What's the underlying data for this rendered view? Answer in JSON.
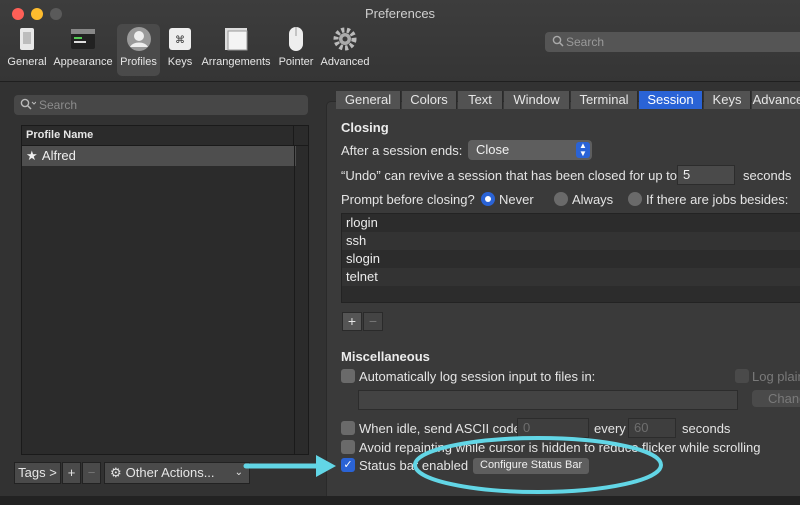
{
  "window": {
    "title": "Preferences"
  },
  "toolbar": {
    "items": [
      {
        "label": "General",
        "icon": "general-icon"
      },
      {
        "label": "Appearance",
        "icon": "appearance-icon"
      },
      {
        "label": "Profiles",
        "icon": "profiles-icon",
        "active": true
      },
      {
        "label": "Keys",
        "icon": "keys-icon"
      },
      {
        "label": "Arrangements",
        "icon": "arrangements-icon"
      },
      {
        "label": "Pointer",
        "icon": "pointer-icon"
      },
      {
        "label": "Advanced",
        "icon": "advanced-gear-icon"
      }
    ],
    "search_placeholder": "Search"
  },
  "profiles": {
    "search_placeholder": "Search",
    "column_header": "Profile Name",
    "items": [
      {
        "name": "Alfred",
        "default": true
      }
    ],
    "tags_label": "Tags >",
    "add_label": "+",
    "remove_label": "−",
    "other_actions_label": "Other Actions..."
  },
  "tabs": [
    {
      "label": "General"
    },
    {
      "label": "Colors"
    },
    {
      "label": "Text"
    },
    {
      "label": "Window"
    },
    {
      "label": "Terminal"
    },
    {
      "label": "Session",
      "active": true
    },
    {
      "label": "Keys"
    },
    {
      "label": "Advanced"
    }
  ],
  "session": {
    "closing_heading": "Closing",
    "after_ends_label": "After a session ends:",
    "after_ends_value": "Close",
    "undo_label": "“Undo” can revive a session that has been closed for up to",
    "undo_value": "5",
    "undo_unit": "seconds",
    "prompt_label": "Prompt before closing?",
    "prompt_options": [
      {
        "label": "Never",
        "selected": true
      },
      {
        "label": "Always",
        "selected": false
      },
      {
        "label": "If there are jobs besides:",
        "selected": false
      }
    ],
    "jobs": [
      "rlogin",
      "ssh",
      "slogin",
      "telnet"
    ],
    "jobs_add": "+",
    "jobs_remove": "−",
    "misc_heading": "Miscellaneous",
    "auto_log_label": "Automatically log session input to files in:",
    "log_plain_label": "Log plain",
    "change_label": "Change",
    "idle_label": "When idle, send ASCII code",
    "idle_code": "0",
    "idle_every": "every",
    "idle_seconds_value": "60",
    "idle_seconds_unit": "seconds",
    "avoid_repaint_label": "Avoid repainting while cursor is hidden to reduce flicker while scrolling",
    "status_bar_label": "Status bar enabled",
    "status_bar_checked": true,
    "configure_status_bar_label": "Configure Status Bar"
  },
  "annotation_color": "#62d6e6",
  "accent_color": "#2a63d6"
}
